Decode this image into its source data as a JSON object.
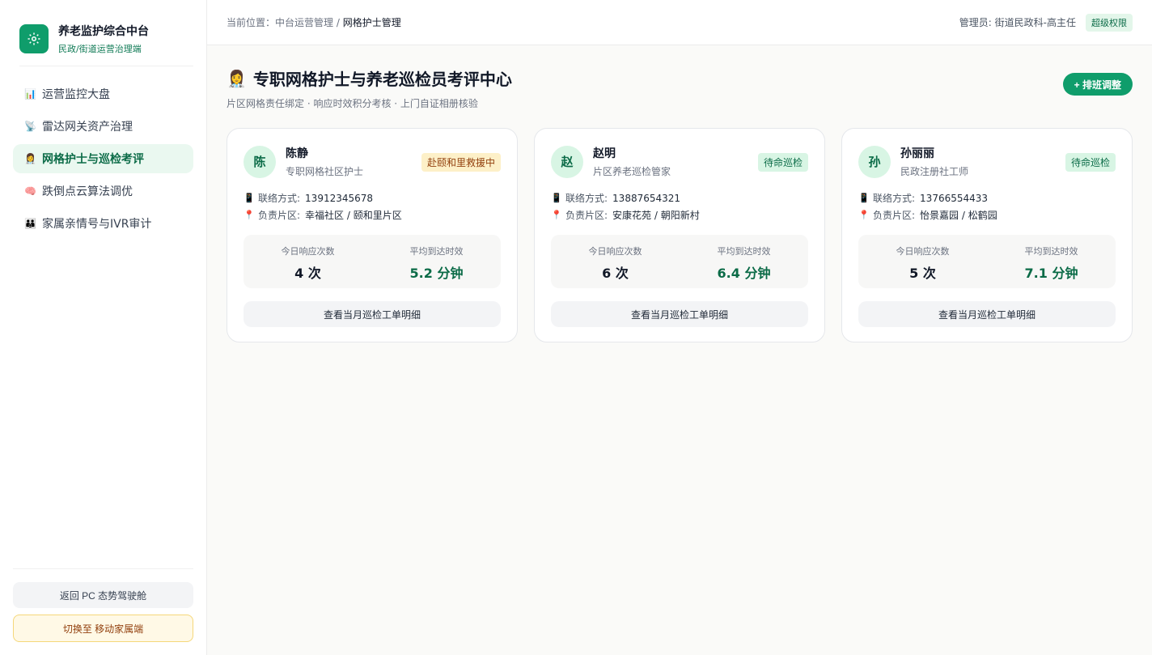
{
  "brand": {
    "title": "养老监护综合中台",
    "subtitle": "民政/街道运营治理端",
    "logo_icon": "gear-icon"
  },
  "nav": [
    {
      "label": "运营监控大盘",
      "icon": "📊",
      "icon_name": "bar-chart-icon",
      "active": false
    },
    {
      "label": "雷达网关资产治理",
      "icon": "📡",
      "icon_name": "radar-icon",
      "active": false
    },
    {
      "label": "网格护士与巡检考评",
      "icon": "👩‍⚕️",
      "icon_name": "nurse-icon",
      "active": true
    },
    {
      "label": "跌倒点云算法调优",
      "icon": "🧠",
      "icon_name": "brain-icon",
      "active": false
    },
    {
      "label": "家属亲情号与IVR审计",
      "icon": "👪",
      "icon_name": "family-icon",
      "active": false
    }
  ],
  "sidebar_bottom": {
    "back_label": "返回 PC 态势驾驶舱",
    "switch_label": "切换至 移动家属端"
  },
  "topbar": {
    "crumb_prefix": "当前位置：",
    "crumb_parent": "中台运营管理",
    "crumb_sep": " / ",
    "crumb_current": "网格护士管理",
    "admin": "管理员: 街道民政科-高主任",
    "role_badge": "超级权限"
  },
  "page": {
    "title_icon": "👩‍⚕️",
    "title": "专职网格护士与养老巡检员考评中心",
    "subtitle": "片区网格责任绑定 · 响应时效积分考核 · 上门自证相册核验",
    "add_button": "+ 排班调整"
  },
  "labels": {
    "contact": "联络方式: ",
    "area": "负责片区: ",
    "today_count": "今日响应次数",
    "avg_time": "平均到达时效",
    "detail_button": "查看当月巡检工单明细"
  },
  "staff": [
    {
      "avatar": "陈",
      "name": "陈静",
      "role": "专职网格社区护士",
      "status": "赴颐和里救援中",
      "status_type": "busy",
      "phone": "13912345678",
      "area": "幸福社区 / 颐和里片区",
      "count": "4 次",
      "avg": "5.2 分钟"
    },
    {
      "avatar": "赵",
      "name": "赵明",
      "role": "片区养老巡检管家",
      "status": "待命巡检",
      "status_type": "idle",
      "phone": "13887654321",
      "area": "安康花苑 / 朝阳新村",
      "count": "6 次",
      "avg": "6.4 分钟"
    },
    {
      "avatar": "孙",
      "name": "孙丽丽",
      "role": "民政注册社工师",
      "status": "待命巡检",
      "status_type": "idle",
      "phone": "13766554433",
      "area": "怡景嘉园 / 松鹤园",
      "count": "5 次",
      "avg": "7.1 分钟"
    }
  ],
  "colors": {
    "accent": "#0f9d6b",
    "accent_dark": "#0b6b47",
    "busy_bg": "#fdf0c8",
    "idle_bg": "#d8f5e4"
  }
}
